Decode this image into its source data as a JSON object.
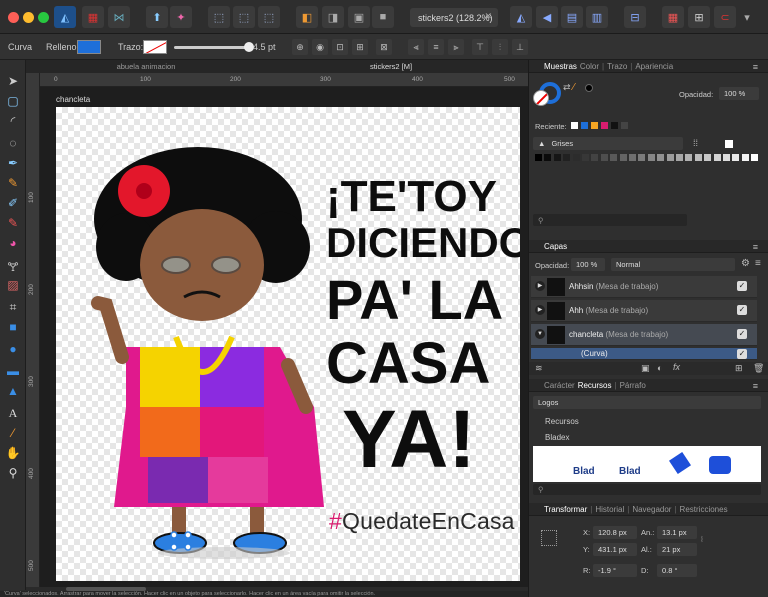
{
  "document": {
    "tab_title": "stickers2 (128.2%)",
    "artboard_name": "chancleta",
    "hashtag": "#QuedateEnCasa",
    "tabs": [
      "abuela animacion",
      "stickers2 [M]"
    ],
    "headline": [
      "¡TE'TOY",
      "DICIENDO",
      "PA' LA",
      "CASA",
      "YA!"
    ]
  },
  "context_bar": {
    "tool_label": "Curva",
    "fill_label": "Relleno:",
    "fill_color": "#1e6fd9",
    "stroke_label": "Trazo:",
    "stroke_width": "4.5 pt"
  },
  "ruler": {
    "unit": "px",
    "h_ticks": [
      "0",
      "100",
      "200",
      "300",
      "400",
      "500"
    ],
    "v_ticks": [
      "100",
      "200",
      "300",
      "400",
      "500"
    ]
  },
  "swatches_panel": {
    "tabs": [
      "Muestras",
      "Color",
      "Trazo",
      "Apariencia"
    ],
    "opacity_label": "Opacidad:",
    "opacity_value": "100 %",
    "recent_label": "Reciente:",
    "recent_colors": [
      "#ffffff",
      "#1e6fd9",
      "#f5a623",
      "#d91c6f",
      "#111111",
      "#444444"
    ],
    "palette_name": "Grises"
  },
  "layers_panel": {
    "title": "Capas",
    "opacity_label": "Opacidad:",
    "opacity_value": "100 %",
    "blend_mode": "Normal",
    "layers": [
      {
        "name": "Ahhsin",
        "type": "(Mesa de trabajo)"
      },
      {
        "name": "Ahh",
        "type": "(Mesa de trabajo)"
      },
      {
        "name": "chancleta",
        "type": "(Mesa de trabajo)"
      },
      {
        "name": "(Curva)",
        "type": ""
      }
    ]
  },
  "assets_panel": {
    "tabs": [
      "Carácter",
      "Recursos",
      "Párrafo"
    ],
    "category": "Logos",
    "groups": [
      "Recursos",
      "Bladex"
    ],
    "preview_labels": [
      "Blad",
      "Blad"
    ]
  },
  "transform_panel": {
    "tabs": [
      "Transformar",
      "Historial",
      "Navegador",
      "Restricciones"
    ],
    "x_label": "X:",
    "x_value": "120.8 px",
    "y_label": "Y:",
    "y_value": "431.1 px",
    "w_label": "An.:",
    "w_value": "13.1 px",
    "h_label": "Al.:",
    "h_value": "21 px",
    "r_label": "R:",
    "r_value": "-1.9 °",
    "d_label": "D:",
    "d_value": "0.8 °"
  },
  "status_bar": {
    "text": "'Curva' seleccionados. Arrastrar para mover la selección. Hacer clic en un objeto para seleccionarlo. Hacer clic en un área vacía para omitir la selección."
  }
}
